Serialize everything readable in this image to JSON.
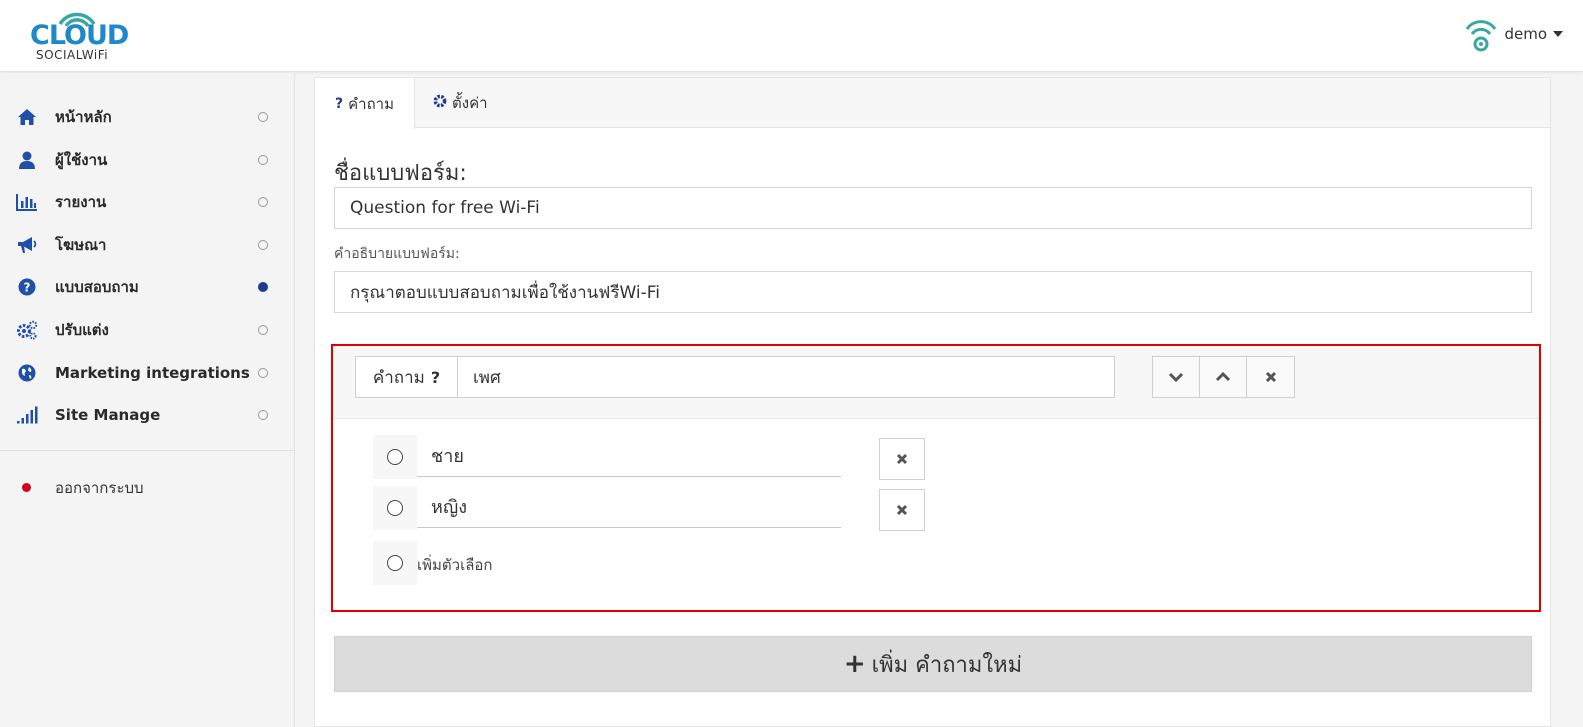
{
  "brand": {
    "word": "CLOUD",
    "sub": "SOCIALWiFi"
  },
  "user": {
    "name": "demo"
  },
  "sidebar": {
    "items": [
      {
        "label": "หน้าหลัก",
        "icon": "home-icon",
        "active": false
      },
      {
        "label": "ผู้ใช้งาน",
        "icon": "user-icon",
        "active": false
      },
      {
        "label": "รายงาน",
        "icon": "bar-chart-icon",
        "active": false
      },
      {
        "label": "โฆษณา",
        "icon": "megaphone-icon",
        "active": false
      },
      {
        "label": "แบบสอบถาม",
        "icon": "question-circle-icon",
        "active": true
      },
      {
        "label": "ปรับแต่ง",
        "icon": "gears-icon",
        "active": false
      },
      {
        "label": "Marketing integrations",
        "icon": "globe-icon",
        "active": false
      },
      {
        "label": "Site Manage",
        "icon": "signal-icon",
        "active": false
      }
    ],
    "logout": "ออกจากระบบ"
  },
  "tabs": [
    {
      "icon": "?",
      "label": "คำถาม",
      "active": true
    },
    {
      "icon": "gear",
      "label": "ตั้งค่า",
      "active": false
    }
  ],
  "form": {
    "name_label": "ชื่อแบบฟอร์ม:",
    "name_value": "Question for free Wi-Fi",
    "desc_label": "คำอธิบายแบบฟอร์ม:",
    "desc_value": "กรุณาตอบแบบสอบถามเพื่อใช้งานฟรีWi-Fi"
  },
  "question": {
    "prefix": "คำถาม",
    "prefix_mark": "?",
    "value": "เพศ",
    "options": [
      {
        "label": "ชาย"
      },
      {
        "label": "หญิง"
      }
    ],
    "add_option": "เพิ่มตัวเลือก"
  },
  "add_question": {
    "plus": "+",
    "label": "เพิ่ม คำถามใหม่"
  },
  "colors": {
    "accent": "#1f3a93",
    "brand": "#1e88c8",
    "highlight": "#e00000",
    "logout": "#d0021b"
  }
}
